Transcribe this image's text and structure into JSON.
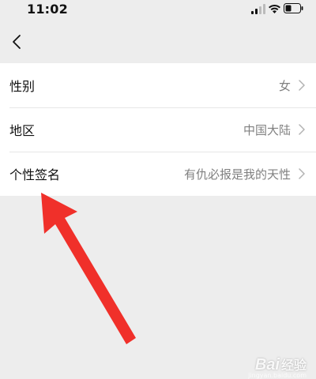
{
  "status_bar": {
    "time": "11:02",
    "icons": [
      "signal-icon",
      "wifi-icon",
      "battery-icon"
    ]
  },
  "nav": {
    "back_icon": "chevron-left-icon"
  },
  "settings": {
    "rows": [
      {
        "label": "性别",
        "value": "女"
      },
      {
        "label": "地区",
        "value": "中国大陆"
      },
      {
        "label": "个性签名",
        "value": "有仇必报是我的天性"
      }
    ]
  },
  "annotation": {
    "arrow_color": "#f0302a"
  },
  "watermark": {
    "logo": "Bai",
    "text": "经验",
    "url": "jingyan.baidu.com"
  }
}
